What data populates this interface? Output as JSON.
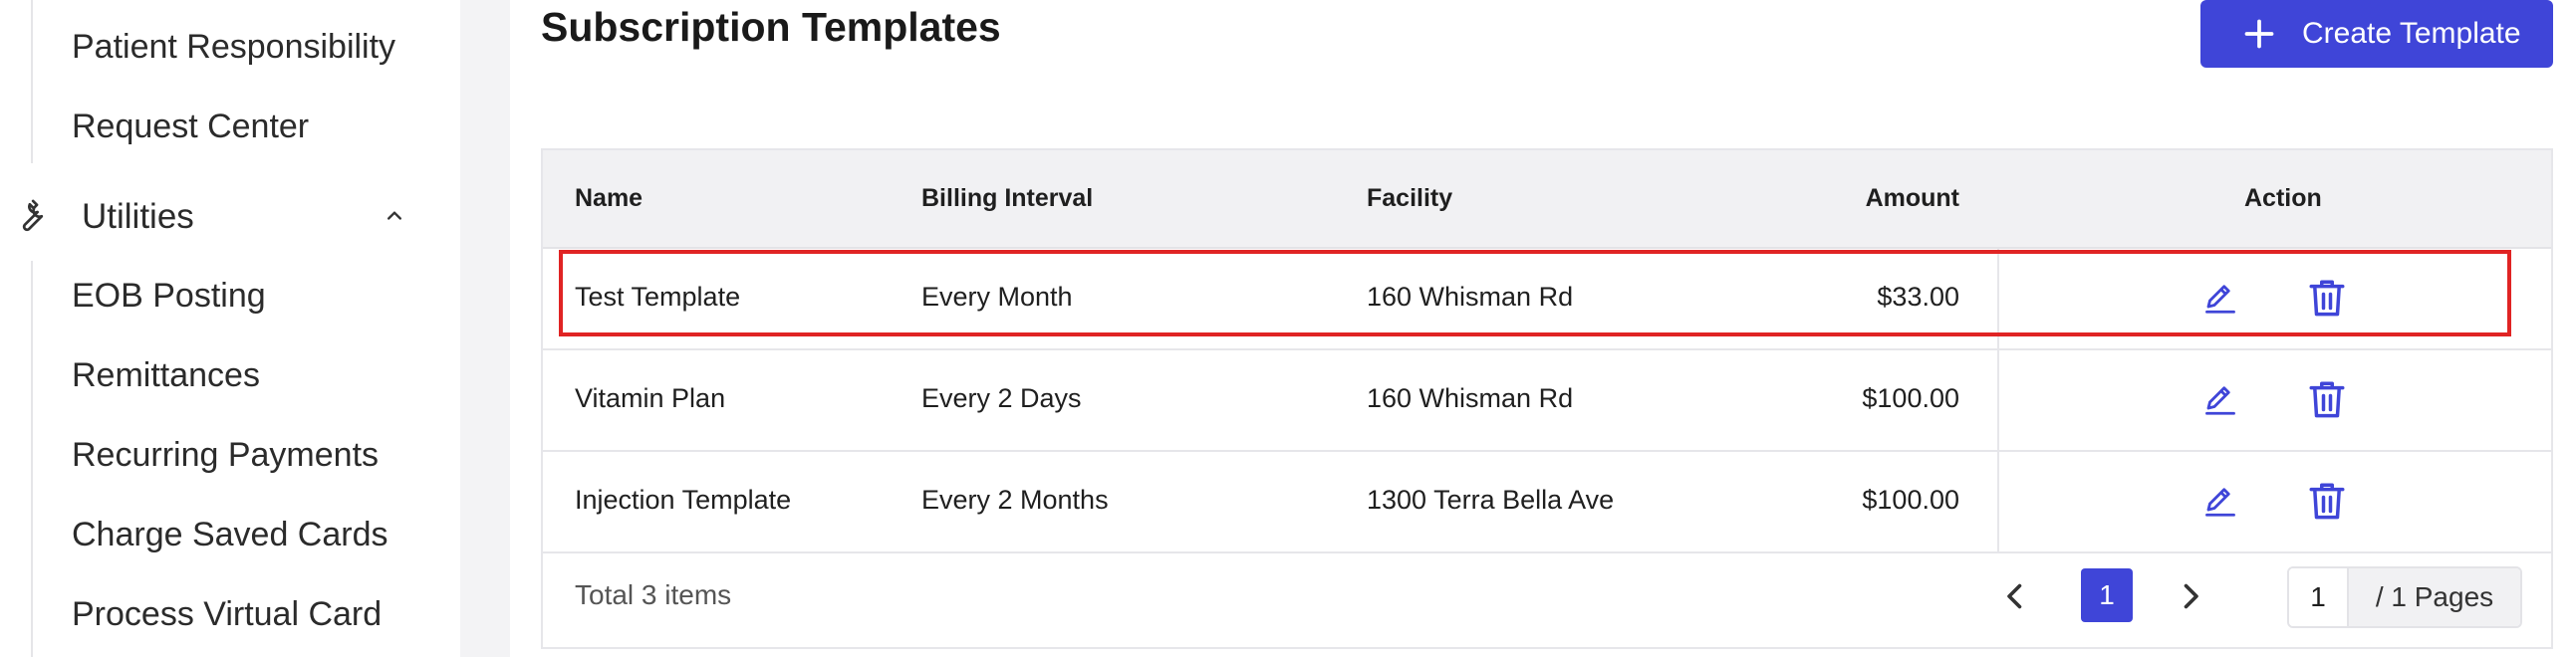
{
  "sidebar": {
    "items_top": [
      {
        "label": "Patient Responsibility"
      },
      {
        "label": "Request Center"
      }
    ],
    "group": {
      "label": "Utilities",
      "icon": "wrench-icon",
      "chevron": "chevron-up-icon"
    },
    "items_group": [
      {
        "label": "EOB Posting"
      },
      {
        "label": "Remittances"
      },
      {
        "label": "Recurring Payments"
      },
      {
        "label": "Charge Saved Cards"
      },
      {
        "label": "Process Virtual Card"
      }
    ]
  },
  "main": {
    "title": "Subscription Templates",
    "create_button": {
      "label": "Create Template",
      "icon": "plus-icon",
      "color": "#3f45d8"
    }
  },
  "table": {
    "columns": [
      "Name",
      "Billing Interval",
      "Facility",
      "Amount",
      "Action"
    ],
    "rows": [
      {
        "name": "Test Template",
        "interval": "Every Month",
        "facility": "160 Whisman Rd",
        "amount": "$33.00",
        "highlighted": true
      },
      {
        "name": "Vitamin Plan",
        "interval": "Every 2 Days",
        "facility": "160 Whisman Rd",
        "amount": "$100.00",
        "highlighted": false
      },
      {
        "name": "Injection Template",
        "interval": "Every 2 Months",
        "facility": "1300 Terra Bella Ave",
        "amount": "$100.00",
        "highlighted": false
      }
    ],
    "action_icons": [
      "edit-icon",
      "trash-icon"
    ],
    "highlight_color": "#e02424"
  },
  "pagination": {
    "total_text": "Total 3 items",
    "current_page": "1",
    "jump_value": "1",
    "pages_suffix": "/ 1 Pages"
  }
}
